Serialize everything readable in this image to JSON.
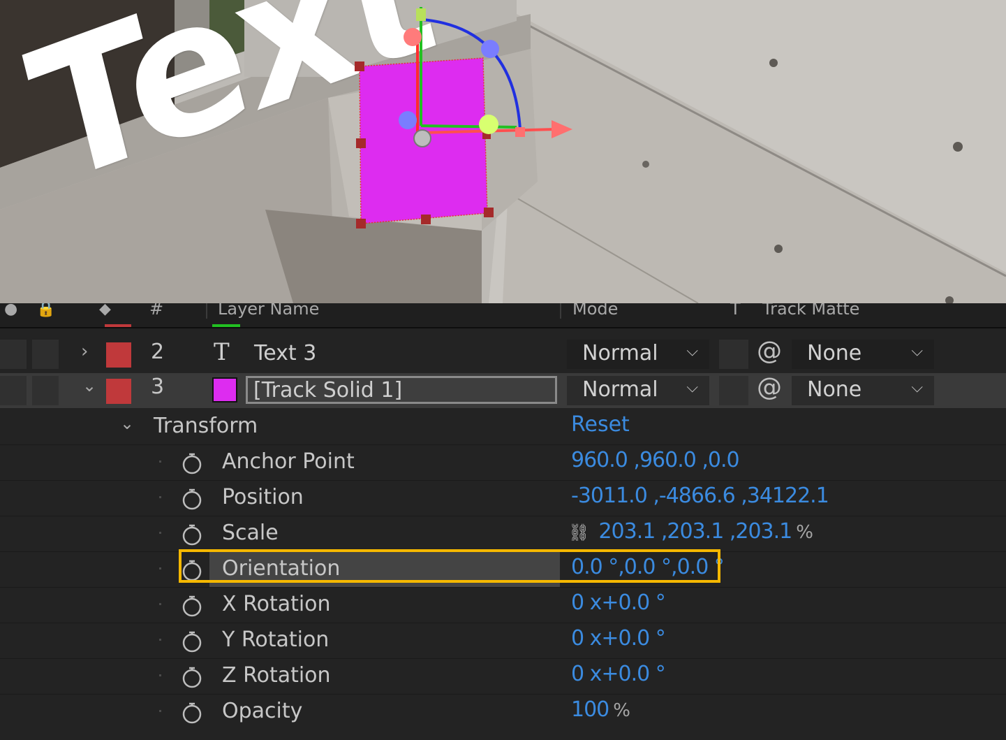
{
  "viewer": {
    "text_layer_text": "Text"
  },
  "timeline": {
    "columns": {
      "layer_name": "Layer Name",
      "mode": "Mode",
      "t": "T",
      "track_matte": "Track Matte",
      "number": "#"
    },
    "layers": [
      {
        "num": "2",
        "type_icon": "T",
        "name": "Text 3",
        "mode": "Normal",
        "matte": "None",
        "label_color": "#c0393b"
      },
      {
        "num": "3",
        "name": "[Track Solid 1]",
        "mode": "Normal",
        "matte": "None",
        "label_color": "#c0393b",
        "swatch_color": "#dd2cf0"
      }
    ],
    "transform": {
      "label": "Transform",
      "reset": "Reset",
      "properties": [
        {
          "name": "Anchor Point",
          "value": "960.0 ,960.0 ,0.0",
          "unit": ""
        },
        {
          "name": "Position",
          "value": "-3011.0 ,-4866.6 ,34122.1",
          "unit": ""
        },
        {
          "name": "Scale",
          "value": "203.1 ,203.1 ,203.1",
          "unit": "%"
        },
        {
          "name": "Orientation",
          "value": "0.0 °,0.0 °,0.0 °",
          "unit": ""
        },
        {
          "name": "X Rotation",
          "value": "0 x+0.0 °",
          "unit": ""
        },
        {
          "name": "Y Rotation",
          "value": "0 x+0.0 °",
          "unit": ""
        },
        {
          "name": "Z Rotation",
          "value": "0 x+0.0 °",
          "unit": ""
        },
        {
          "name": "Opacity",
          "value": "100",
          "unit": "%"
        }
      ]
    }
  },
  "colors": {
    "highlight": "#f5b800",
    "value_blue": "#3b8be0",
    "solid_magenta": "#dd2cf0"
  }
}
